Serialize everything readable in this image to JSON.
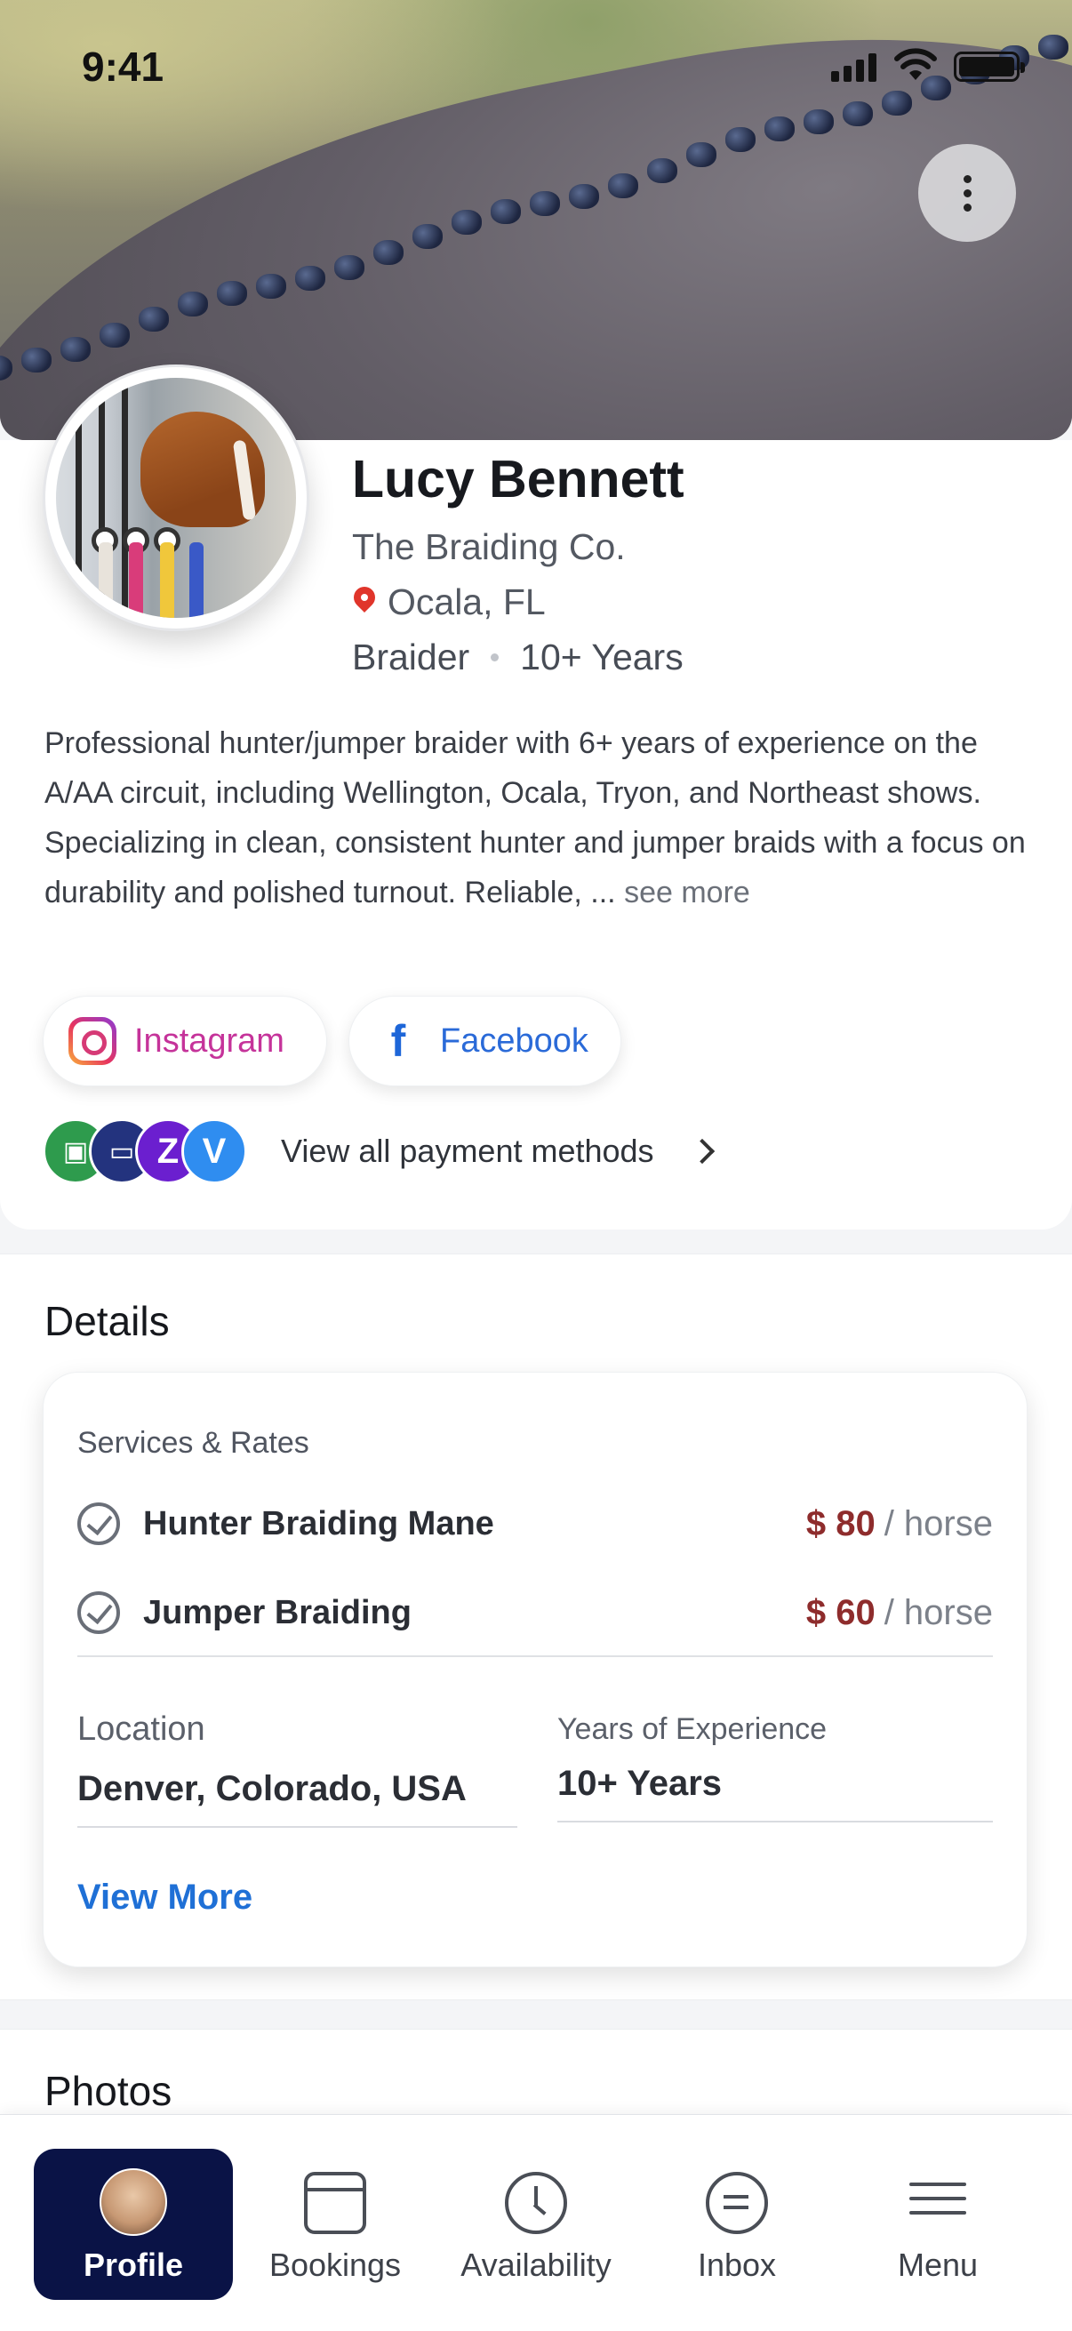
{
  "status_bar": {
    "time": "9:41"
  },
  "profile": {
    "name": "Lucy Bennett",
    "company": "The Braiding Co.",
    "location": "Ocala, FL",
    "role": "Braider",
    "experience": "10+ Years",
    "bio_line1": "Professional hunter/jumper braider with 6+ years of experience on the A/AA circuit, including Wellington, Ocala, Tryon, and Northeast shows.",
    "bio_line2": "Specializing in clean, consistent hunter and jumper braids with a focus on durability and polished turnout. Reliable, ...",
    "see_more": "see more"
  },
  "social": {
    "instagram": "Instagram",
    "facebook": "Facebook"
  },
  "payments": {
    "label": "View all payment methods",
    "icons": [
      {
        "name": "cash-icon",
        "color": "#2e9b4d"
      },
      {
        "name": "card-icon",
        "color": "#23337e"
      },
      {
        "name": "zelle-icon",
        "color": "#6b1fcf"
      },
      {
        "name": "venmo-icon",
        "color": "#2f8df0"
      }
    ]
  },
  "details": {
    "title": "Details",
    "services_title": "Services & Rates",
    "services": [
      {
        "name": "Hunter Braiding Mane",
        "price": "$ 80",
        "unit": "/ horse"
      },
      {
        "name": "Jumper Braiding",
        "price": "$ 60",
        "unit": "/ horse"
      }
    ],
    "location_label": "Location",
    "location_value": "Denver, Colorado, USA",
    "experience_label": "Years of Experience",
    "experience_value": "10+ Years",
    "view_more": "View More"
  },
  "photos": {
    "title": "Photos"
  },
  "tabbar": {
    "items": [
      {
        "label": "Profile",
        "icon": "avatar-icon",
        "active": true
      },
      {
        "label": "Bookings",
        "icon": "calendar-icon"
      },
      {
        "label": "Availability",
        "icon": "clock-icon"
      },
      {
        "label": "Inbox",
        "icon": "chat-icon"
      },
      {
        "label": "Menu",
        "icon": "menu-icon"
      }
    ]
  },
  "colors": {
    "accent": "#1f70d6",
    "price": "#8e2c2c",
    "active_tab": "#0a1346"
  }
}
